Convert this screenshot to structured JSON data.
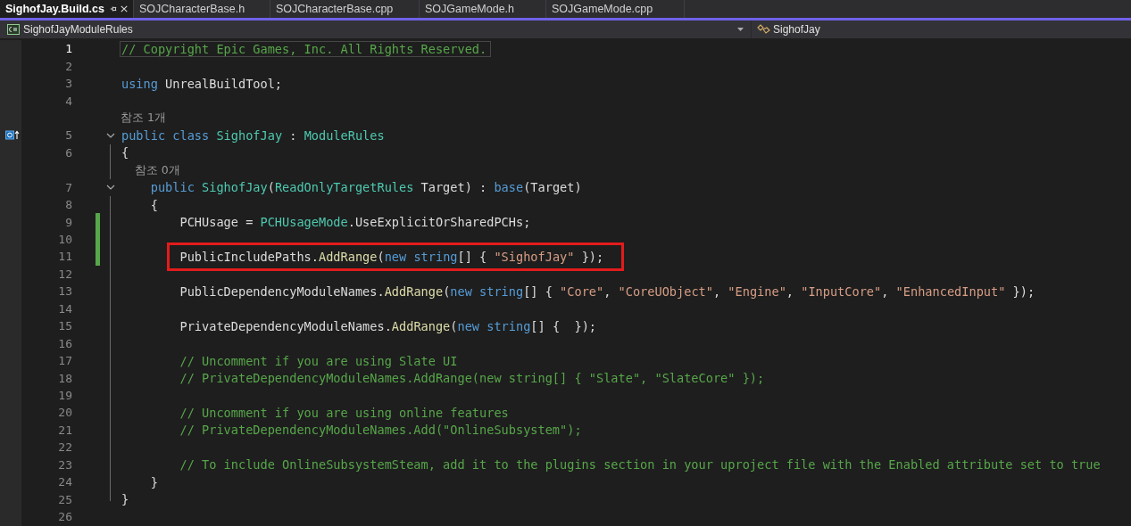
{
  "tabs": [
    {
      "label": "SighofJay.Build.cs",
      "selected": true,
      "pinned": true
    },
    {
      "label": "SOJCharacterBase.h",
      "selected": false,
      "pinned": false
    },
    {
      "label": "SOJCharacterBase.cpp",
      "selected": false,
      "pinned": false
    },
    {
      "label": "SOJGameMode.h",
      "selected": false,
      "pinned": false
    },
    {
      "label": "SOJGameMode.cpp",
      "selected": false,
      "pinned": false
    }
  ],
  "navigation_bar": {
    "type_selector": "SighofJayModuleRules",
    "member_selector": "SighofJay"
  },
  "lines": [
    {
      "number": "1",
      "current": true,
      "tokens": [
        {
          "kind": "comment",
          "text": "// Copyright Epic Games, Inc. All Rights Reserved."
        }
      ]
    },
    {
      "number": "2"
    },
    {
      "number": "3",
      "tokens": [
        {
          "kind": "keyword",
          "text": "using"
        },
        {
          "kind": "plain",
          "text": " UnrealBuildTool;"
        }
      ]
    },
    {
      "number": "4"
    },
    {
      "number": "5",
      "lens": "참조 1개",
      "inherit_glyph": true,
      "expanded": true,
      "tokens": [
        {
          "kind": "keyword",
          "text": "public class"
        },
        {
          "kind": "type",
          "text": " SighofJay"
        },
        {
          "kind": "plain",
          "text": " : "
        },
        {
          "kind": "type",
          "text": "ModuleRules"
        }
      ]
    },
    {
      "number": "6",
      "tokens": [
        {
          "kind": "plain",
          "text": "{"
        }
      ]
    },
    {
      "number": "7",
      "lens": "    참조 0개",
      "expanded": true,
      "tokens": [
        {
          "kind": "keyword",
          "text": "    public"
        },
        {
          "kind": "type",
          "text": " SighofJay"
        },
        {
          "kind": "plain",
          "text": "("
        },
        {
          "kind": "type",
          "text": "ReadOnlyTargetRules"
        },
        {
          "kind": "plain",
          "text": " Target) : "
        },
        {
          "kind": "keyword",
          "text": "base"
        },
        {
          "kind": "plain",
          "text": "(Target)"
        }
      ]
    },
    {
      "number": "8",
      "tokens": [
        {
          "kind": "plain",
          "text": "    {"
        }
      ]
    },
    {
      "number": "9",
      "changed": true,
      "tokens": [
        {
          "kind": "plain",
          "text": "        PCHUsage = "
        },
        {
          "kind": "type",
          "text": "PCHUsageMode"
        },
        {
          "kind": "plain",
          "text": ".UseExplicitOrSharedPCHs;"
        }
      ]
    },
    {
      "number": "10",
      "changed": true
    },
    {
      "number": "11",
      "changed": true,
      "highlighted": true,
      "tokens": [
        {
          "kind": "plain",
          "text": "        PublicIncludePaths."
        },
        {
          "kind": "method",
          "text": "AddRange"
        },
        {
          "kind": "plain",
          "text": "("
        },
        {
          "kind": "keyword",
          "text": "new string"
        },
        {
          "kind": "plain",
          "text": "[] { "
        },
        {
          "kind": "string",
          "text": "\"SighofJay\""
        },
        {
          "kind": "plain",
          "text": " });"
        }
      ]
    },
    {
      "number": "12"
    },
    {
      "number": "13",
      "tokens": [
        {
          "kind": "plain",
          "text": "        PublicDependencyModuleNames."
        },
        {
          "kind": "method",
          "text": "AddRange"
        },
        {
          "kind": "plain",
          "text": "("
        },
        {
          "kind": "keyword",
          "text": "new string"
        },
        {
          "kind": "plain",
          "text": "[] { "
        },
        {
          "kind": "string",
          "text": "\"Core\""
        },
        {
          "kind": "plain",
          "text": ", "
        },
        {
          "kind": "string",
          "text": "\"CoreUObject\""
        },
        {
          "kind": "plain",
          "text": ", "
        },
        {
          "kind": "string",
          "text": "\"Engine\""
        },
        {
          "kind": "plain",
          "text": ", "
        },
        {
          "kind": "string",
          "text": "\"InputCore\""
        },
        {
          "kind": "plain",
          "text": ", "
        },
        {
          "kind": "string",
          "text": "\"EnhancedInput\""
        },
        {
          "kind": "plain",
          "text": " });"
        }
      ]
    },
    {
      "number": "14"
    },
    {
      "number": "15",
      "tokens": [
        {
          "kind": "plain",
          "text": "        PrivateDependencyModuleNames."
        },
        {
          "kind": "method",
          "text": "AddRange"
        },
        {
          "kind": "plain",
          "text": "("
        },
        {
          "kind": "keyword",
          "text": "new string"
        },
        {
          "kind": "plain",
          "text": "[] {  });"
        }
      ]
    },
    {
      "number": "16"
    },
    {
      "number": "17",
      "tokens": [
        {
          "kind": "comment",
          "text": "        // Uncomment if you are using Slate UI"
        }
      ]
    },
    {
      "number": "18",
      "tokens": [
        {
          "kind": "comment",
          "text": "        // PrivateDependencyModuleNames.AddRange(new string[] { \"Slate\", \"SlateCore\" });"
        }
      ]
    },
    {
      "number": "19"
    },
    {
      "number": "20",
      "tokens": [
        {
          "kind": "comment",
          "text": "        // Uncomment if you are using online features"
        }
      ]
    },
    {
      "number": "21",
      "tokens": [
        {
          "kind": "comment",
          "text": "        // PrivateDependencyModuleNames.Add(\"OnlineSubsystem\");"
        }
      ]
    },
    {
      "number": "22"
    },
    {
      "number": "23",
      "tokens": [
        {
          "kind": "comment",
          "text": "        // To include OnlineSubsystemSteam, add it to the plugins section in your uproject file with the Enabled attribute set to true"
        }
      ]
    },
    {
      "number": "24",
      "tokens": [
        {
          "kind": "plain",
          "text": "    }"
        }
      ]
    },
    {
      "number": "25",
      "tokens": [
        {
          "kind": "plain",
          "text": "}"
        }
      ]
    },
    {
      "number": "26"
    }
  ]
}
